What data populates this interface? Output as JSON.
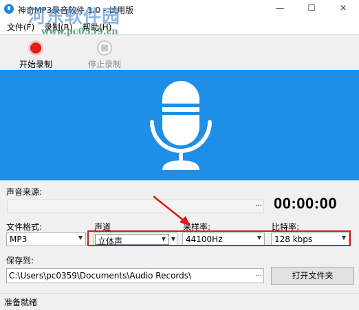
{
  "window": {
    "title": "神奇MP3录音软件 1.0 - 试用版",
    "minimize": "—",
    "maximize": "☐",
    "close": "✕"
  },
  "watermark": {
    "line1": "河东软件园",
    "line2": "www.pc0359.cn"
  },
  "menu": {
    "file": "文件(F)",
    "record": "录制(R)",
    "help": "帮助(H)"
  },
  "toolbar": {
    "start_label": "开始录制",
    "stop_label": "停止录制"
  },
  "source": {
    "label": "声音来源:",
    "value": "",
    "browse": "..."
  },
  "timer": "00:00:00",
  "format": {
    "label": "文件格式:",
    "value": "MP3"
  },
  "channel": {
    "label": "声道",
    "value": "立体声"
  },
  "sample_rate": {
    "label": "采样率:",
    "value": "44100Hz"
  },
  "bitrate": {
    "label": "比特率:",
    "value": "128 kbps"
  },
  "save": {
    "label": "保存到:",
    "path": "C:\\Users\\pc0359\\Documents\\Audio Records\\",
    "browse": "...",
    "open_folder": "打开文件夹"
  },
  "status": "准备就绪",
  "colors": {
    "hero_bg": "#1e8ee6",
    "record_red": "#e21b1b",
    "highlight_red": "#e01414"
  }
}
